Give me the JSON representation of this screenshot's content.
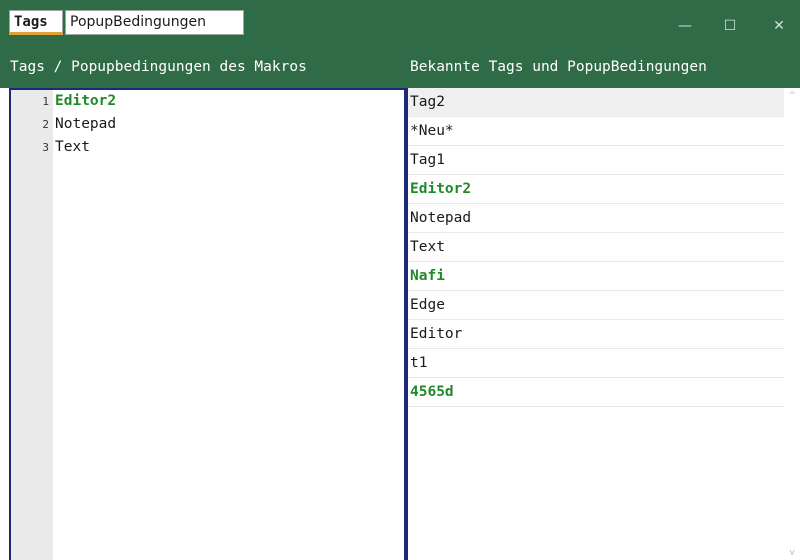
{
  "tabs": [
    {
      "label": "Tags",
      "active": true
    },
    {
      "label": "PopupBedingungen",
      "active": false
    }
  ],
  "window_controls": {
    "minimize": "—",
    "maximize": "☐",
    "close": "✕"
  },
  "headers": {
    "left": "Tags / Popupbedingungen des Makros",
    "right": "Bekannte Tags und PopupBedingungen"
  },
  "editor": {
    "lines": [
      {
        "num": "1",
        "text": "Editor2",
        "highlight": true
      },
      {
        "num": "2",
        "text": "Notepad",
        "highlight": false
      },
      {
        "num": "3",
        "text": "Text",
        "highlight": false
      }
    ]
  },
  "known_list": {
    "items": [
      {
        "text": "Tag2",
        "highlight": false,
        "selected": true
      },
      {
        "text": "*Neu*",
        "highlight": false,
        "selected": false
      },
      {
        "text": "Tag1",
        "highlight": false,
        "selected": false
      },
      {
        "text": "Editor2",
        "highlight": true,
        "selected": false
      },
      {
        "text": "Notepad",
        "highlight": false,
        "selected": false
      },
      {
        "text": "Text",
        "highlight": false,
        "selected": false
      },
      {
        "text": "Nafi",
        "highlight": true,
        "selected": false
      },
      {
        "text": "Edge",
        "highlight": false,
        "selected": false
      },
      {
        "text": "Editor",
        "highlight": false,
        "selected": false
      },
      {
        "text": "t1",
        "highlight": false,
        "selected": false
      },
      {
        "text": "4565d",
        "highlight": true,
        "selected": false
      }
    ]
  },
  "scrollbar": {
    "up": "^",
    "down": "v"
  },
  "colors": {
    "titlebar": "#2e6b46",
    "highlight_text": "#1f8a28",
    "panel_border": "#1d2a7a",
    "active_tab_underline": "#e2a23a"
  }
}
